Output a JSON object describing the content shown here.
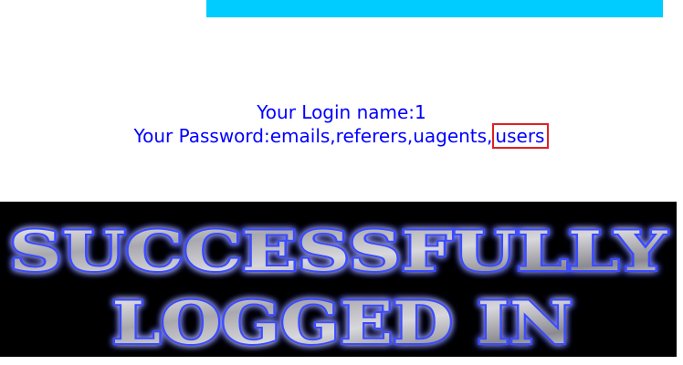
{
  "colors": {
    "top_bar": "#00ccff",
    "info_text": "#0000ff",
    "highlight_border": "#e02020",
    "banner_bg": "#000000",
    "banner_glow": "#2a3cff"
  },
  "login": {
    "name_label": "Your Login name:",
    "name_value": "1",
    "password_label": "Your Password:",
    "password_value_prefix": "emails,referers,uagents,",
    "password_value_highlight": "users"
  },
  "banner": {
    "line1": "SUCCESSFULLY",
    "line2": "LOGGED IN"
  }
}
